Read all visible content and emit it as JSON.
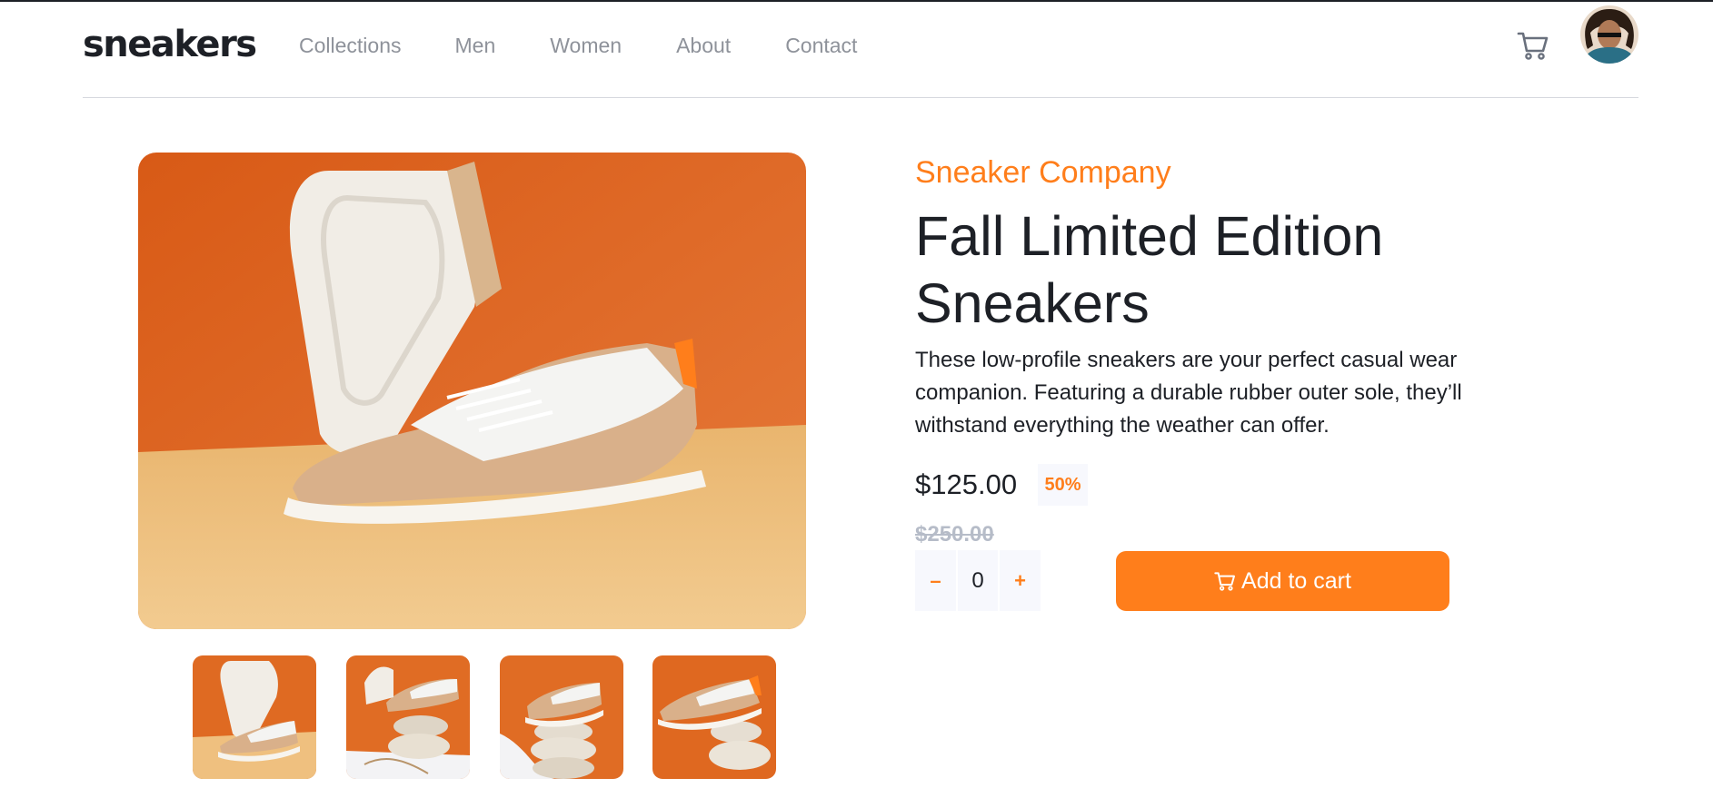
{
  "header": {
    "logo": "sneakers",
    "nav": [
      "Collections",
      "Men",
      "Women",
      "About",
      "Contact"
    ]
  },
  "icons": {
    "cart": "cart-icon",
    "avatar": "user-avatar"
  },
  "product": {
    "company": "Sneaker Company",
    "title_line1": "Fall Limited Edition",
    "title_line2": "Sneakers",
    "description": "These low-profile sneakers are your perfect casual wear companion. Featuring a durable rubber outer sole, they’ll withstand everything the weather can offer.",
    "price": "$125.00",
    "discount": "50%",
    "original_price": "$250.00",
    "quantity": "0",
    "minus": "–",
    "plus": "+",
    "add_to_cart": "Add to cart"
  },
  "colors": {
    "accent": "#ff7e1b",
    "dark": "#1d2026",
    "muted": "#8e929a",
    "light_bg": "#f7f8fd"
  }
}
